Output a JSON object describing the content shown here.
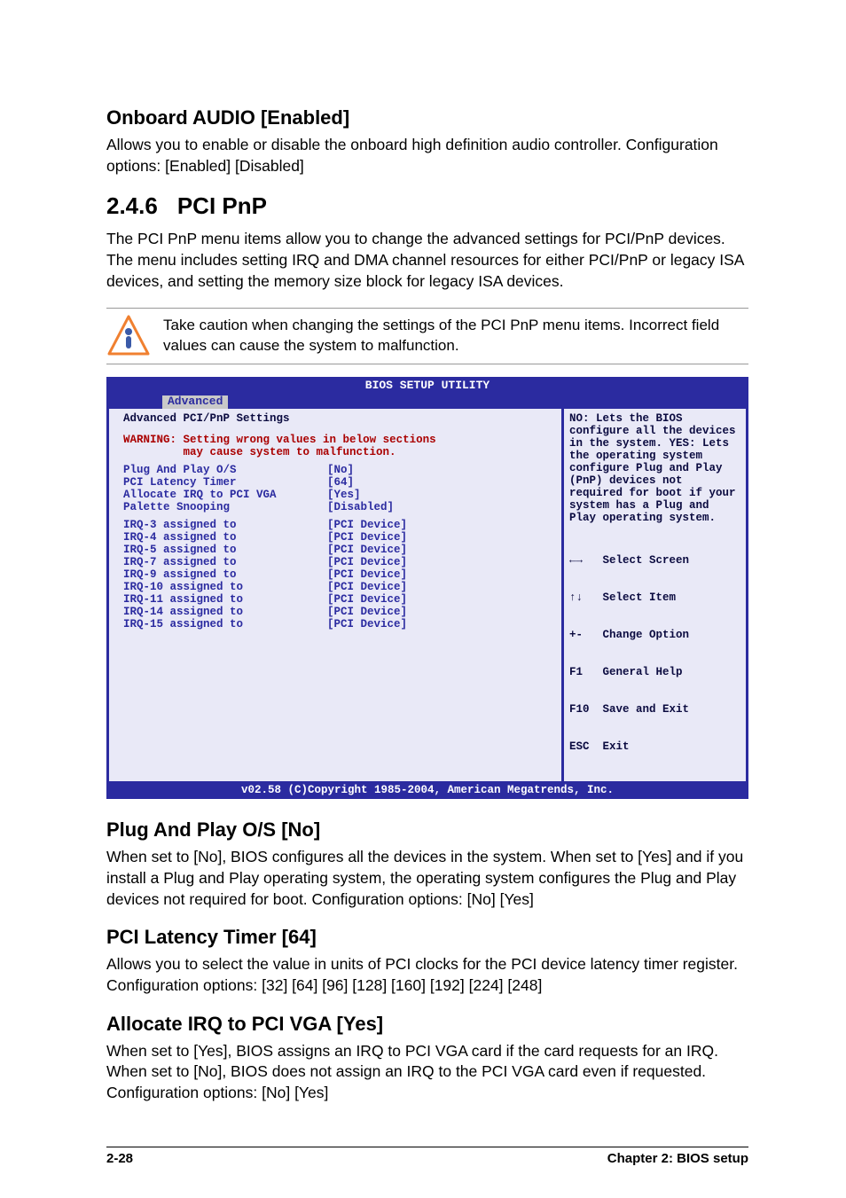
{
  "section_audio": {
    "heading": "Onboard AUDIO [Enabled]",
    "text1": "Allows you to enable or disable the onboard high definition audio controller. Configuration options: [Enabled] [Disabled]"
  },
  "section_pcipnp": {
    "num": "2.4.6",
    "title": "PCI PnP",
    "intro": "The PCI PnP menu items allow you to change the advanced settings for PCI/PnP devices. The menu includes setting IRQ and DMA channel resources for either PCI/PnP or legacy ISA devices, and setting the memory size block for legacy ISA devices.",
    "warn": "Take caution when changing the settings of the PCI PnP menu items. Incorrect field values can cause the system to malfunction."
  },
  "bios": {
    "title": "BIOS SETUP UTILITY",
    "tab": "Advanced",
    "subhead": "Advanced PCI/PnP Settings",
    "warning_label": "WARNING:",
    "warning_body": "Setting wrong values in below sections\n         may cause system to malfunction.",
    "options": [
      {
        "label": "Plug And Play O/S",
        "value": "[No]"
      },
      {
        "label": "PCI Latency Timer",
        "value": "[64]"
      },
      {
        "label": "Allocate IRQ to PCI VGA",
        "value": "[Yes]"
      },
      {
        "label": "Palette Snooping",
        "value": "[Disabled]"
      }
    ],
    "irq": [
      {
        "label": "IRQ-3 assigned to",
        "value": "[PCI Device]"
      },
      {
        "label": "IRQ-4 assigned to",
        "value": "[PCI Device]"
      },
      {
        "label": "IRQ-5 assigned to",
        "value": "[PCI Device]"
      },
      {
        "label": "IRQ-7 assigned to",
        "value": "[PCI Device]"
      },
      {
        "label": "IRQ-9 assigned to",
        "value": "[PCI Device]"
      },
      {
        "label": "IRQ-10 assigned to",
        "value": "[PCI Device]"
      },
      {
        "label": "IRQ-11 assigned to",
        "value": "[PCI Device]"
      },
      {
        "label": "IRQ-14 assigned to",
        "value": "[PCI Device]"
      },
      {
        "label": "IRQ-15 assigned to",
        "value": "[PCI Device]"
      }
    ],
    "help_text": "NO: Lets the BIOS configure all the devices in the system. YES: Lets the operating system configure Plug and Play (PnP) devices not required for boot if your system has a Plug and Play operating system.",
    "nav": [
      {
        "icon": "←→",
        "label": "Select Screen"
      },
      {
        "icon": "↑↓",
        "label": "Select Item"
      },
      {
        "icon": "+-",
        "label": "Change Option"
      },
      {
        "icon": "F1",
        "label": "General Help"
      },
      {
        "icon": "F10",
        "label": "Save and Exit"
      },
      {
        "icon": "ESC",
        "label": "Exit"
      }
    ],
    "footer": "v02.58 (C)Copyright 1985-2004, American Megatrends, Inc."
  },
  "section_plug": {
    "heading": "Plug And Play O/S [No]",
    "text": "When set to [No], BIOS configures all the devices in the system. When set to [Yes] and if you install a Plug and Play operating system, the operating system configures the Plug and Play devices not required for boot. Configuration options: [No] [Yes]"
  },
  "section_latency": {
    "heading": "PCI Latency Timer [64]",
    "text": "Allows you to select the value in units of PCI clocks for the PCI device latency timer register. Configuration options: [32] [64] [96] [128] [160] [192] [224] [248]"
  },
  "section_irq": {
    "heading": "Allocate IRQ to PCI VGA [Yes]",
    "text": "When set to [Yes], BIOS assigns an IRQ to PCI VGA card if the card requests for an IRQ. When set to [No], BIOS does not assign an IRQ to the PCI VGA card even if requested. Configuration options: [No] [Yes]"
  },
  "footer": {
    "left": "2-28",
    "right": "Chapter 2: BIOS setup"
  }
}
